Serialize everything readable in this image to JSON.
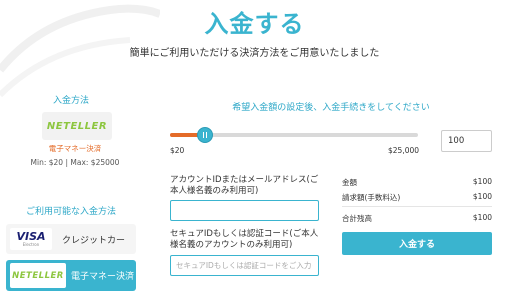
{
  "header": {
    "title": "入金する",
    "subtitle": "簡単にご利用いただける決済方法をご用意いたしました"
  },
  "sidebar": {
    "method_heading": "入金方法",
    "method_logo": "NETELLER",
    "method_type": "電子マネー決済",
    "method_limits": "Min: $20 | Max: $25000",
    "available_heading": "ご利用可能な入金方法",
    "methods": [
      {
        "logo": "VISA",
        "logo_sub": "Electron",
        "label": "クレジットカー"
      },
      {
        "logo": "NETELLER",
        "label": "電子マネー決済"
      }
    ]
  },
  "amount": {
    "heading": "希望入金額の設定後、入金手続きをしてください",
    "min_label": "$20",
    "max_label": "$25,000",
    "value": "100",
    "slider_fraction": 0.0032
  },
  "form": {
    "account_label": "アカウントIDまたはメールアドレス(ご本人様名義のみ利用可)",
    "secure_label": "セキュアIDもしくは認証コード(ご本人様名義のアカウントのみ利用可)",
    "secure_placeholder": "セキュアIDもしくは認証コードをご入力ください"
  },
  "summary": {
    "rows": [
      {
        "label": "金額",
        "value": "$100"
      },
      {
        "label": "請求額(手数料込)",
        "value": "$100"
      },
      {
        "label": "合計残高",
        "value": "$100"
      }
    ],
    "button_label": "入金する"
  },
  "colors": {
    "accent": "#3ab4cf",
    "orange": "#e46b28",
    "neteller_green": "#8dc63f"
  }
}
